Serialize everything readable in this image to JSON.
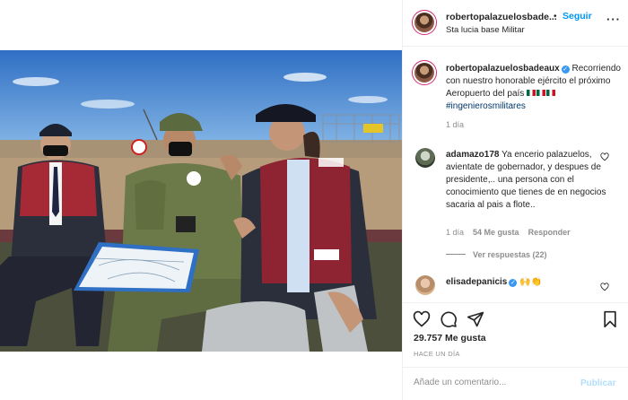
{
  "header": {
    "username": "robertopalazuelosbade...",
    "separator": "•",
    "follow_label": "Seguir",
    "location": "Sta lucia base Militar",
    "more_icon": "more-horizontal-icon"
  },
  "caption": {
    "username": "robertopalazuelosbadeaux",
    "verified_icon": "verified-badge-icon",
    "text": "Recorriendo con nuestro honorable ejército el próximo Aeropuerto del país",
    "flags": "🇲🇽🇲🇽🇲🇽",
    "hashtag": "#ingenierosmilitares",
    "time": "1 día"
  },
  "comments": [
    {
      "username": "adamazo178",
      "text": "Ya encerio palazuelos, avientate de gobernador, y despues de presidente,.. una persona con el conocimiento que tienes de en negocios sacaria al pais a flote..",
      "time": "1 día",
      "likes": "54 Me gusta",
      "reply_label": "Responder",
      "view_replies": "Ver respuestas (22)"
    },
    {
      "username": "elisadepanicis",
      "text": "🙌👏"
    }
  ],
  "actions": {
    "like_icon": "heart-icon",
    "comment_icon": "comment-icon",
    "share_icon": "send-icon",
    "save_icon": "bookmark-icon",
    "likes": "29.757 Me gusta",
    "posted": "HACE UN DÍA"
  },
  "add_comment": {
    "placeholder": "Añade un comentario...",
    "publish_label": "Publicar"
  },
  "colors": {
    "accent": "#0095f6",
    "verified": "#3897f0",
    "publish_disabled": "#b2dffc",
    "muted": "#8e8e8e"
  }
}
